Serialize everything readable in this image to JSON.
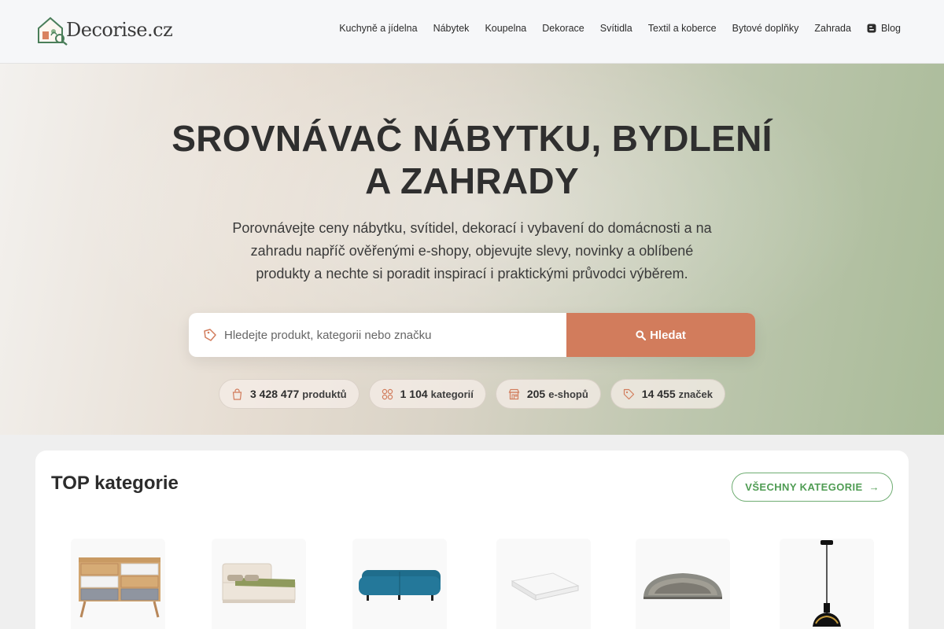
{
  "header": {
    "logo_text": "Decorise.cz",
    "nav": [
      {
        "label": "Kuchyně a jídelna"
      },
      {
        "label": "Nábytek"
      },
      {
        "label": "Koupelna"
      },
      {
        "label": "Dekorace"
      },
      {
        "label": "Svítidla"
      },
      {
        "label": "Textil a koberce"
      },
      {
        "label": "Bytové doplňky"
      },
      {
        "label": "Zahrada"
      },
      {
        "label": "Blog",
        "icon": "blog-icon"
      }
    ]
  },
  "hero": {
    "title_line1": "SROVNÁVAČ NÁBYTKU, BYDLENÍ",
    "title_line2": "A ZAHRADY",
    "subtitle": "Porovnávejte ceny nábytku, svítidel, dekorací i vybavení do domácnosti a na zahradu napříč ověřenými e-shopy, objevujte slevy, novinky a oblíbené produkty a nechte si poradit inspirací i praktickými průvodci výběrem.",
    "search_placeholder": "Hledejte produkt, kategorii nebo značku",
    "search_button": "Hledat",
    "stats": [
      {
        "value": "3 428 477",
        "unit": "produktů",
        "icon": "shopping-bag-icon"
      },
      {
        "value": "1 104",
        "unit": "kategorií",
        "icon": "categories-icon"
      },
      {
        "value": "205",
        "unit": "e-shopů",
        "icon": "store-icon"
      },
      {
        "value": "14 455",
        "unit": "značek",
        "icon": "tag-icon"
      }
    ]
  },
  "categories": {
    "title": "TOP kategorie",
    "all_button": "VŠECHNY KATEGORIE",
    "arrow": "→",
    "items": [
      {
        "icon": "dresser-image"
      },
      {
        "icon": "bed-image"
      },
      {
        "icon": "sofa-image"
      },
      {
        "icon": "mattress-image"
      },
      {
        "icon": "stair-rug-image"
      },
      {
        "icon": "pendant-lamp-image"
      }
    ]
  },
  "colors": {
    "accent": "#d27c5c",
    "green": "#4f9c53",
    "text": "#2f2f2f"
  }
}
